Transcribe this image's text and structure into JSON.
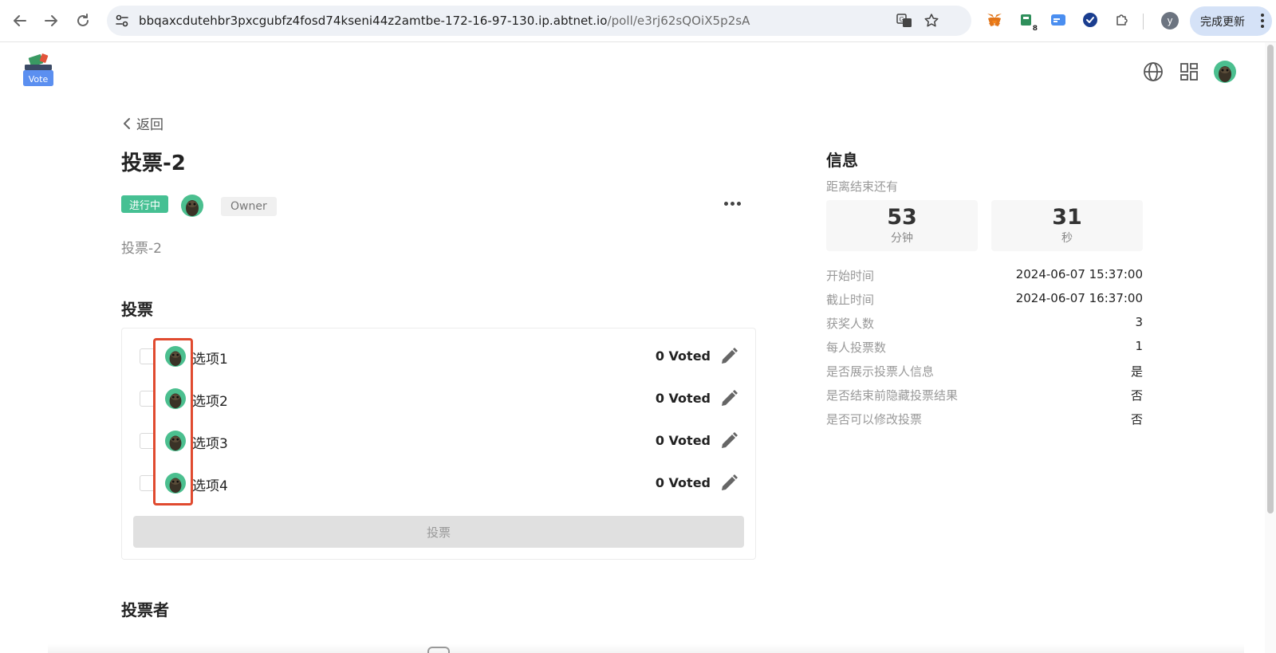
{
  "browser": {
    "url_host": "bbqaxcdutehbr3pxcgubfz4fosd74kseni44z2amtbe-172-16-97-130.ip.abtnet.io",
    "url_path": "/poll/e3rj62sQOiX5p2sA",
    "extension_badge": "8",
    "profile_initial": "y",
    "update_label": "完成更新"
  },
  "app": {
    "logo_text": "Vote"
  },
  "poll": {
    "back_label": "返回",
    "title": "投票-2",
    "status": "进行中",
    "owner_tag": "Owner",
    "description": "投票-2",
    "vote_section_title": "投票",
    "options": [
      {
        "label": "选项1",
        "count": "0 Voted"
      },
      {
        "label": "选项2",
        "count": "0 Voted"
      },
      {
        "label": "选项3",
        "count": "0 Voted"
      },
      {
        "label": "选项4",
        "count": "0 Voted"
      }
    ],
    "vote_button": "投票",
    "voters_section_title": "投票者"
  },
  "info": {
    "title": "信息",
    "countdown_label": "距离结束还有",
    "minutes_value": "53",
    "minutes_unit": "分钟",
    "seconds_value": "31",
    "seconds_unit": "秒",
    "rows": [
      {
        "key": "开始时间",
        "value": "2024-06-07 15:37:00"
      },
      {
        "key": "截止时间",
        "value": "2024-06-07 16:37:00"
      },
      {
        "key": "获奖人数",
        "value": "3"
      },
      {
        "key": "每人投票数",
        "value": "1"
      },
      {
        "key": "是否展示投票人信息",
        "value": "是"
      },
      {
        "key": "是否结束前隐藏投票结果",
        "value": "否"
      },
      {
        "key": "是否可以修改投票",
        "value": "否"
      }
    ]
  },
  "colors": {
    "status_green": "#46c093",
    "highlight_red": "#e04a2f",
    "update_button_bg": "#d5e2f7"
  }
}
